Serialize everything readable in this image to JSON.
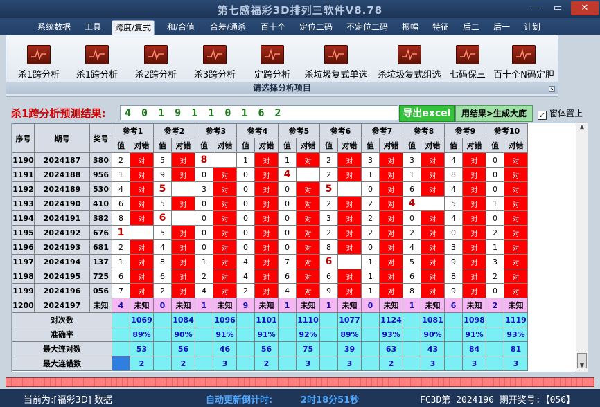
{
  "window": {
    "title": "第七感福彩3D排列三软件V8.78",
    "minimize": "—",
    "maximize": "▭",
    "close": "✕"
  },
  "menu": [
    "系统数据",
    "工具",
    "跨度/复式",
    "和/合值",
    "合差/通杀",
    "百十个",
    "定位二码",
    "不定位二码",
    "振幅",
    "特征",
    "后二",
    "后一",
    "计划"
  ],
  "toolbar": {
    "items": [
      "杀1跨分析",
      "杀1跨分析",
      "杀2跨分析",
      "杀3跨分析",
      "定跨分析",
      "杀垃圾复式单选",
      "杀垃圾复式组选",
      "七码保三",
      "百十个N码定胆"
    ],
    "group_label": "请选择分析项目",
    "icon": "chart-icon"
  },
  "result": {
    "label": "杀1跨分析预测结果:",
    "value": "4 0 1 9 1 1 0 1 6 2",
    "export_button": "导出excel",
    "generate_button": "用结果>生成大底",
    "checkbox_label": "窗体置上",
    "checkbox_mark": "✓"
  },
  "grid": {
    "headers": {
      "seq": "序号",
      "period": "期号",
      "prize": "奖号",
      "refs": [
        "参考1",
        "参考2",
        "参考3",
        "参考4",
        "参考5",
        "参考6",
        "参考7",
        "参考8",
        "参考9",
        "参考10"
      ],
      "value": "值",
      "check": "对错"
    },
    "dui_label": "对",
    "unknown_label": "未知",
    "rows": [
      {
        "seq": "1190",
        "period": "2024187",
        "prize": "380",
        "vals": [
          "2",
          "5",
          "8",
          "1",
          "1",
          "2",
          "3",
          "3",
          "4",
          "0"
        ],
        "dui": [
          1,
          1,
          0,
          1,
          1,
          1,
          1,
          1,
          1,
          1
        ]
      },
      {
        "seq": "1191",
        "period": "2024188",
        "prize": "956",
        "vals": [
          "1",
          "9",
          "0",
          "0",
          "4",
          "2",
          "1",
          "1",
          "8",
          "0"
        ],
        "dui": [
          1,
          1,
          1,
          1,
          0,
          1,
          1,
          1,
          1,
          1
        ]
      },
      {
        "seq": "1192",
        "period": "2024189",
        "prize": "530",
        "vals": [
          "4",
          "5",
          "3",
          "0",
          "0",
          "5",
          "0",
          "6",
          "4",
          "0"
        ],
        "dui": [
          1,
          0,
          1,
          1,
          1,
          0,
          1,
          1,
          1,
          1
        ]
      },
      {
        "seq": "1193",
        "period": "2024190",
        "prize": "410",
        "vals": [
          "6",
          "5",
          "0",
          "0",
          "0",
          "2",
          "2",
          "4",
          "5",
          "1"
        ],
        "dui": [
          1,
          1,
          1,
          1,
          1,
          1,
          1,
          0,
          1,
          1
        ]
      },
      {
        "seq": "1194",
        "period": "2024191",
        "prize": "382",
        "vals": [
          "8",
          "6",
          "0",
          "0",
          "0",
          "3",
          "2",
          "0",
          "4",
          "0"
        ],
        "dui": [
          1,
          0,
          1,
          1,
          1,
          1,
          1,
          1,
          1,
          1
        ]
      },
      {
        "seq": "1195",
        "period": "2024192",
        "prize": "676",
        "vals": [
          "1",
          "5",
          "0",
          "0",
          "0",
          "2",
          "2",
          "2",
          "0",
          "2"
        ],
        "dui": [
          0,
          1,
          1,
          1,
          1,
          1,
          1,
          1,
          1,
          1
        ]
      },
      {
        "seq": "1196",
        "period": "2024193",
        "prize": "681",
        "vals": [
          "2",
          "4",
          "0",
          "0",
          "0",
          "8",
          "0",
          "4",
          "3",
          "1"
        ],
        "dui": [
          1,
          1,
          1,
          1,
          1,
          1,
          1,
          1,
          1,
          1
        ]
      },
      {
        "seq": "1197",
        "period": "2024194",
        "prize": "137",
        "vals": [
          "1",
          "8",
          "1",
          "4",
          "7",
          "6",
          "1",
          "5",
          "9",
          "3"
        ],
        "dui": [
          1,
          1,
          1,
          1,
          1,
          0,
          1,
          1,
          1,
          1
        ]
      },
      {
        "seq": "1198",
        "period": "2024195",
        "prize": "725",
        "vals": [
          "6",
          "6",
          "2",
          "4",
          "6",
          "6",
          "1",
          "6",
          "8",
          "2"
        ],
        "dui": [
          1,
          1,
          1,
          1,
          1,
          1,
          1,
          1,
          1,
          1
        ]
      },
      {
        "seq": "1199",
        "period": "2024196",
        "prize": "056",
        "vals": [
          "7",
          "2",
          "4",
          "2",
          "4",
          "9",
          "1",
          "8",
          "9",
          "0"
        ],
        "dui": [
          1,
          1,
          1,
          1,
          1,
          1,
          1,
          1,
          1,
          1
        ]
      }
    ],
    "last": {
      "seq": "1200",
      "period": "2024197",
      "prize": "未知",
      "vals": [
        "4",
        "0",
        "1",
        "9",
        "1",
        "1",
        "0",
        "1",
        "6",
        "2"
      ]
    },
    "stats": [
      {
        "label": "对次数",
        "vals": [
          "1069",
          "1084",
          "1096",
          "1101",
          "1110",
          "1077",
          "1124",
          "1081",
          "1098",
          "1119"
        ]
      },
      {
        "label": "准确率",
        "vals": [
          "89%",
          "90%",
          "91%",
          "91%",
          "92%",
          "89%",
          "93%",
          "90%",
          "91%",
          "93%"
        ]
      },
      {
        "label": "最大连对数",
        "vals": [
          "53",
          "56",
          "46",
          "56",
          "75",
          "39",
          "63",
          "43",
          "84",
          "81"
        ]
      },
      {
        "label": "最大连错数",
        "vals": [
          "2",
          "2",
          "3",
          "2",
          "3",
          "3",
          "2",
          "3",
          "3",
          "3"
        ]
      }
    ]
  },
  "status": {
    "current": "当前为:[福彩3D] 数据",
    "countdown_label": "自动更新倒计时:",
    "countdown_value": "2时18分51秒",
    "issue": "FC3D第 2024196 期开奖号:【056】"
  },
  "colors": {
    "red": "#ff0000",
    "pink": "#f4b7f3",
    "cyan": "#7af0f4",
    "green": "#34c23a"
  }
}
